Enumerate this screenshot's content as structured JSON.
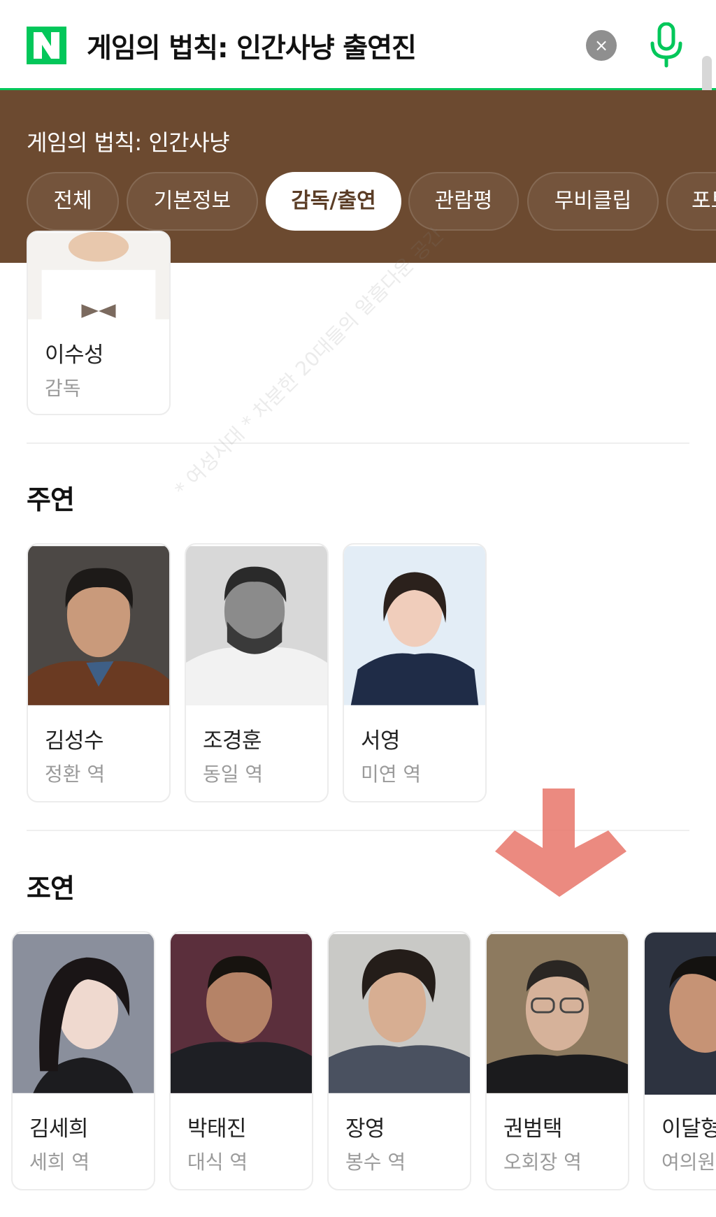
{
  "search": {
    "query": "게임의 법칙: 인간사냥 출연진",
    "clear_icon": "×"
  },
  "header": {
    "movie_title": "게임의 법칙: 인간사냥",
    "tabs": [
      {
        "label": "전체"
      },
      {
        "label": "기본정보"
      },
      {
        "label": "감독/출연",
        "active": true
      },
      {
        "label": "관람평"
      },
      {
        "label": "무비클립"
      },
      {
        "label": "포토"
      }
    ]
  },
  "director": {
    "name": "이수성",
    "role": "감독"
  },
  "main_cast": {
    "title": "주연",
    "people": [
      {
        "name": "김성수",
        "role": "정환 역"
      },
      {
        "name": "조경훈",
        "role": "동일 역"
      },
      {
        "name": "서영",
        "role": "미연 역"
      }
    ]
  },
  "supporting_cast": {
    "title": "조연",
    "people": [
      {
        "name": "김세희",
        "role": "세희 역"
      },
      {
        "name": "박태진",
        "role": "대식 역"
      },
      {
        "name": "장영",
        "role": "봉수 역"
      },
      {
        "name": "권범택",
        "role": "오회장 역"
      },
      {
        "name": "이달형",
        "role": "여의원 역"
      }
    ]
  },
  "watermark_text": "* 여성시대 * 차분한 20대들의 알흠다운 공간",
  "colors": {
    "brand": "#03c75a",
    "header_bg": "#6c4a30",
    "annotation": "#e8766a"
  }
}
